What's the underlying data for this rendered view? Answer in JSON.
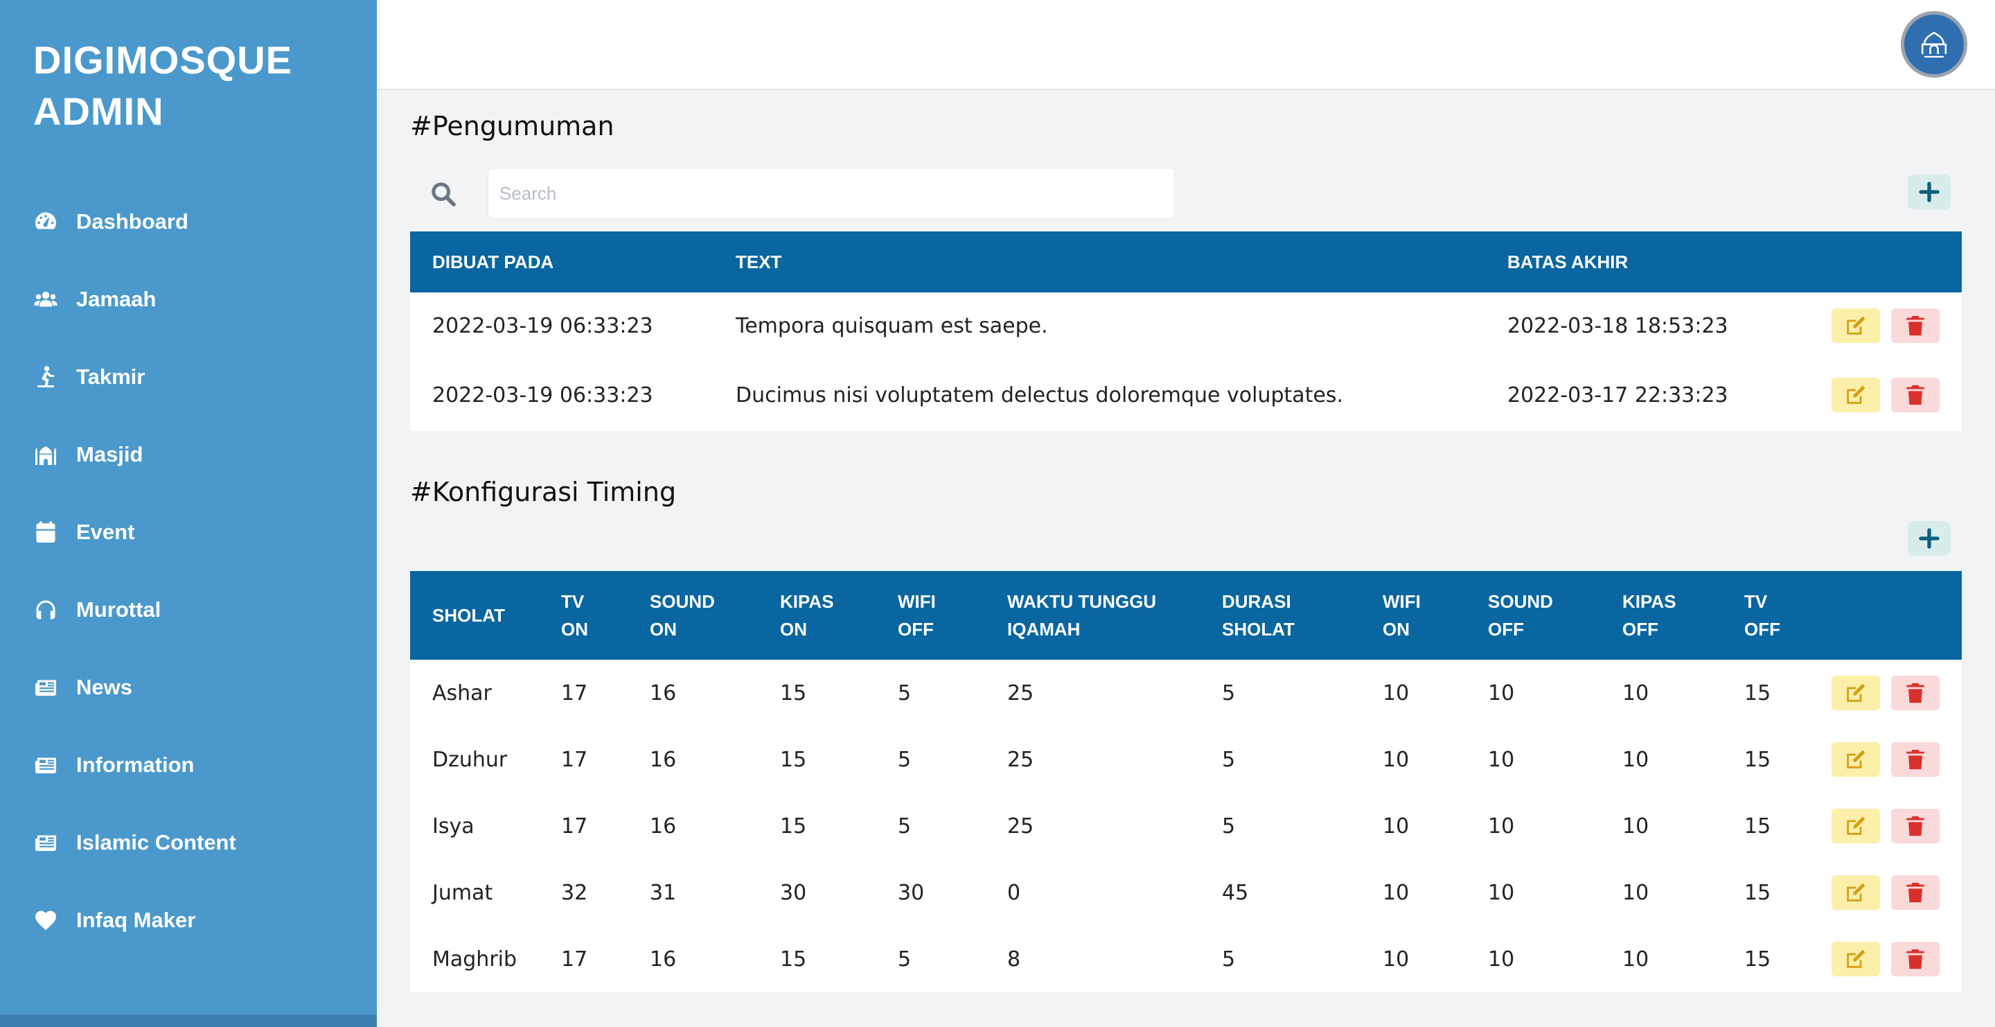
{
  "sidebar": {
    "brand_line1": "DIGIMOSQUE",
    "brand_line2": "ADMIN",
    "items": [
      {
        "label": "Dashboard",
        "icon": "tachometer-icon"
      },
      {
        "label": "Jamaah",
        "icon": "users-icon"
      },
      {
        "label": "Takmir",
        "icon": "praying-person-icon"
      },
      {
        "label": "Masjid",
        "icon": "mosque-icon"
      },
      {
        "label": "Event",
        "icon": "calendar-icon"
      },
      {
        "label": "Murottal",
        "icon": "headphones-icon"
      },
      {
        "label": "News",
        "icon": "newspaper-icon"
      },
      {
        "label": "Information",
        "icon": "newspaper-icon"
      },
      {
        "label": "Islamic Content",
        "icon": "newspaper-icon"
      },
      {
        "label": "Infaq Maker",
        "icon": "heart-icon"
      }
    ]
  },
  "colors": {
    "sidebar_bg": "#4b99cc",
    "table_header_bg": "#0966a0",
    "edit_bg": "#fbefaa",
    "edit_icon": "#d4a017",
    "delete_bg": "#f9d9d9",
    "delete_icon": "#d9302c",
    "add_bg": "#d9ecec",
    "add_icon": "#0b5f7f"
  },
  "pengumuman": {
    "title": "#Pengumuman",
    "search_placeholder": "Search",
    "columns": [
      "DIBUAT PADA",
      "TEXT",
      "BATAS AKHIR"
    ],
    "rows": [
      {
        "dibuat": "2022-03-19 06:33:23",
        "text": "Tempora quisquam est saepe.",
        "batas": "2022-03-18 18:53:23"
      },
      {
        "dibuat": "2022-03-19 06:33:23",
        "text": "Ducimus nisi voluptatem delectus doloremque voluptates.",
        "batas": "2022-03-17 22:33:23"
      }
    ]
  },
  "timing": {
    "title": "#Konfigurasi Timing",
    "columns": [
      {
        "line1": "SHOLAT",
        "line2": ""
      },
      {
        "line1": "TV",
        "line2": "ON"
      },
      {
        "line1": "SOUND",
        "line2": "ON"
      },
      {
        "line1": "KIPAS",
        "line2": "ON"
      },
      {
        "line1": "WIFI",
        "line2": "OFF"
      },
      {
        "line1": "WAKTU TUNGGU",
        "line2": "IQAMAH"
      },
      {
        "line1": "DURASI",
        "line2": "SHOLAT"
      },
      {
        "line1": "WIFI",
        "line2": "ON"
      },
      {
        "line1": "SOUND",
        "line2": "OFF"
      },
      {
        "line1": "KIPAS",
        "line2": "OFF"
      },
      {
        "line1": "TV",
        "line2": "OFF"
      }
    ],
    "rows": [
      [
        "Ashar",
        "17",
        "16",
        "15",
        "5",
        "25",
        "5",
        "10",
        "10",
        "10",
        "15"
      ],
      [
        "Dzuhur",
        "17",
        "16",
        "15",
        "5",
        "25",
        "5",
        "10",
        "10",
        "10",
        "15"
      ],
      [
        "Isya",
        "17",
        "16",
        "15",
        "5",
        "25",
        "5",
        "10",
        "10",
        "10",
        "15"
      ],
      [
        "Jumat",
        "32",
        "31",
        "30",
        "30",
        "0",
        "45",
        "10",
        "10",
        "10",
        "15"
      ],
      [
        "Maghrib",
        "17",
        "16",
        "15",
        "5",
        "8",
        "5",
        "10",
        "10",
        "10",
        "15"
      ]
    ]
  }
}
